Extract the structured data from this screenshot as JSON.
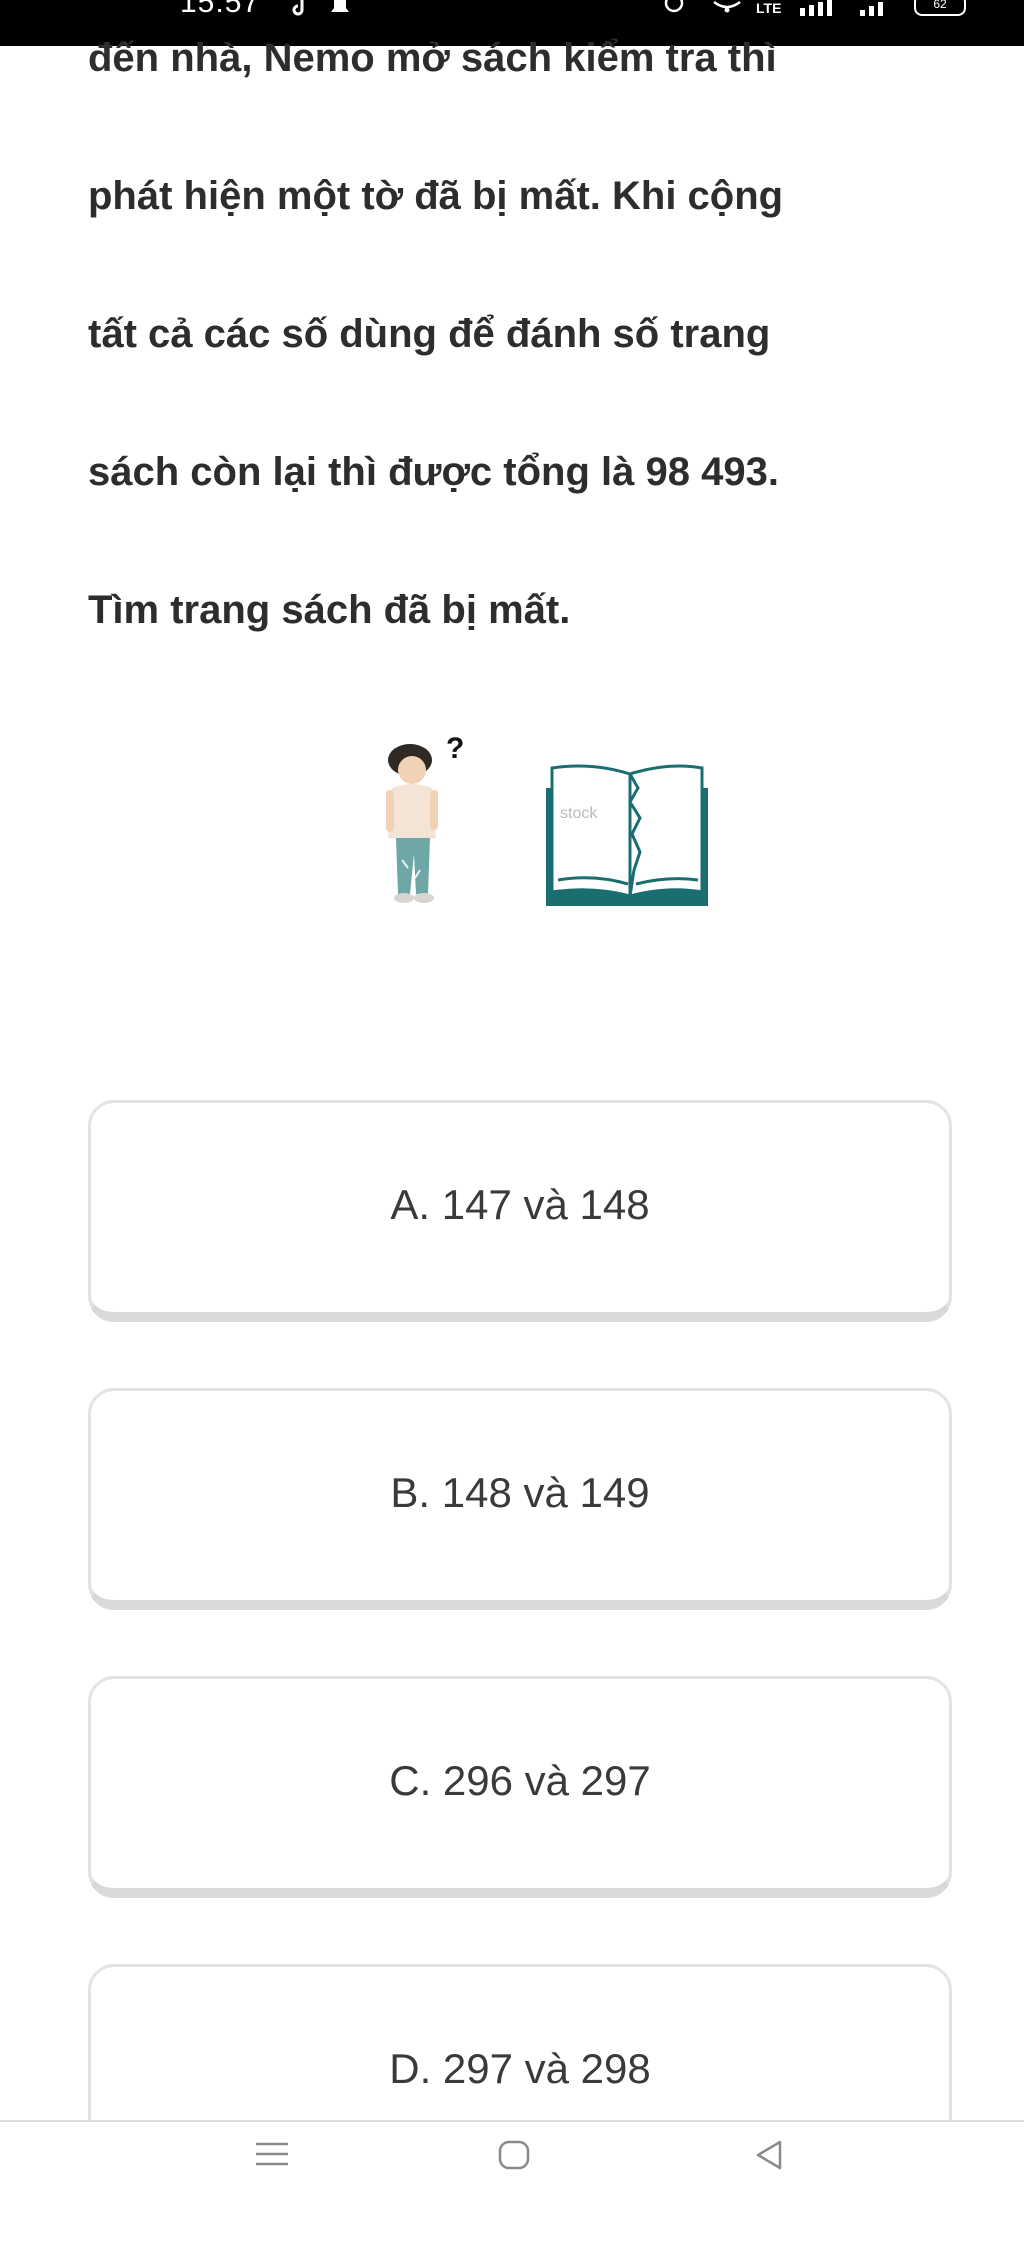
{
  "status_bar": {
    "time": "15:57",
    "network": "LTE",
    "battery": "62"
  },
  "question": {
    "lines": [
      "đến nhà, Nemo mở sách kiểm tra thì",
      "phát hiện một tờ đã bị mất. Khi cộng",
      "tất cả các số dùng để đánh số trang",
      "sách còn lại thì được tổng là 98 493.",
      "Tìm trang sách đã bị mất."
    ]
  },
  "illustration": {
    "question_mark": "?",
    "watermark": "stock"
  },
  "options": [
    {
      "label": "A. 147 và 148"
    },
    {
      "label": "B. 148 và 149"
    },
    {
      "label": "C. 296 và 297"
    },
    {
      "label": "D. 297 và 298"
    }
  ]
}
